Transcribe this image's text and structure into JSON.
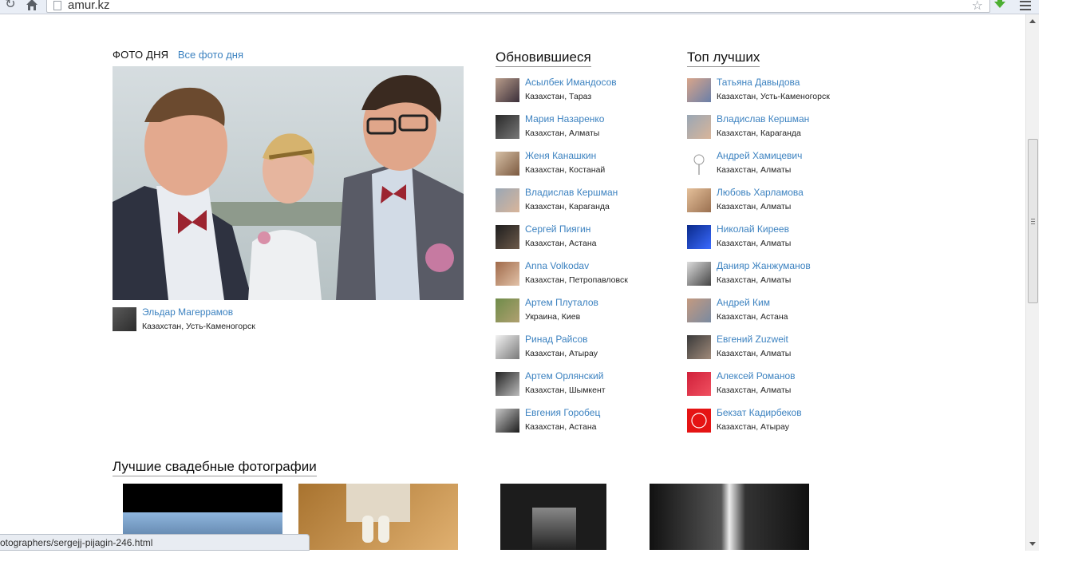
{
  "browser": {
    "url": "amur.kz",
    "icons": {
      "back": "reload-icon",
      "home": "home-icon",
      "star": "star-icon",
      "extension": "download-arrow-icon",
      "menu": "menu-icon"
    }
  },
  "photo_of_day": {
    "title": "ФОТО ДНЯ",
    "all_link": "Все фото дня",
    "author": {
      "name": "Эльдар Магеррамов",
      "location": "Казахстан, Усть-Каменогорск"
    }
  },
  "updated": {
    "title": "Обновившиеся",
    "users": [
      {
        "name": "Асылбек Имандосов",
        "location": "Казахстан, Тараз"
      },
      {
        "name": "Мария Назаренко",
        "location": "Казахстан, Алматы"
      },
      {
        "name": "Женя Канашкин",
        "location": "Казахстан, Костанай"
      },
      {
        "name": "Владислав Кершман",
        "location": "Казахстан, Караганда"
      },
      {
        "name": "Сергей Пиягин",
        "location": "Казахстан, Астана"
      },
      {
        "name": "Anna Volkodav",
        "location": "Казахстан, Петропавловск"
      },
      {
        "name": "Артем Плуталов",
        "location": "Украина, Киев"
      },
      {
        "name": "Ринад Райсов",
        "location": "Казахстан, Атырау"
      },
      {
        "name": "Артем Орлянский",
        "location": "Казахстан, Шымкент"
      },
      {
        "name": "Евгения Горобец",
        "location": "Казахстан, Астана"
      }
    ]
  },
  "top": {
    "title": "Топ лучших",
    "users": [
      {
        "name": "Татьяна Давыдова",
        "location": "Казахстан, Усть-Каменогорск"
      },
      {
        "name": "Владислав Кершман",
        "location": "Казахстан, Караганда"
      },
      {
        "name": "Андрей Хамицевич",
        "location": "Казахстан, Алматы"
      },
      {
        "name": "Любовь Харламова",
        "location": "Казахстан, Алматы"
      },
      {
        "name": "Николай Киреев",
        "location": "Казахстан, Алматы"
      },
      {
        "name": "Данияр Жанжуманов",
        "location": "Казахстан, Алматы"
      },
      {
        "name": "Андрей Ким",
        "location": "Казахстан, Астана"
      },
      {
        "name": "Евгений Zuzweit",
        "location": "Казахстан, Алматы"
      },
      {
        "name": "Алексей Романов",
        "location": "Казахстан, Алматы"
      },
      {
        "name": "Бекзат Кадирбеков",
        "location": "Казахстан, Атырау"
      }
    ]
  },
  "best_wedding": {
    "title": "Лучшие свадебные фотографии"
  },
  "status_bar": {
    "text": "otographers/sergejj-pijagin-246.html"
  }
}
